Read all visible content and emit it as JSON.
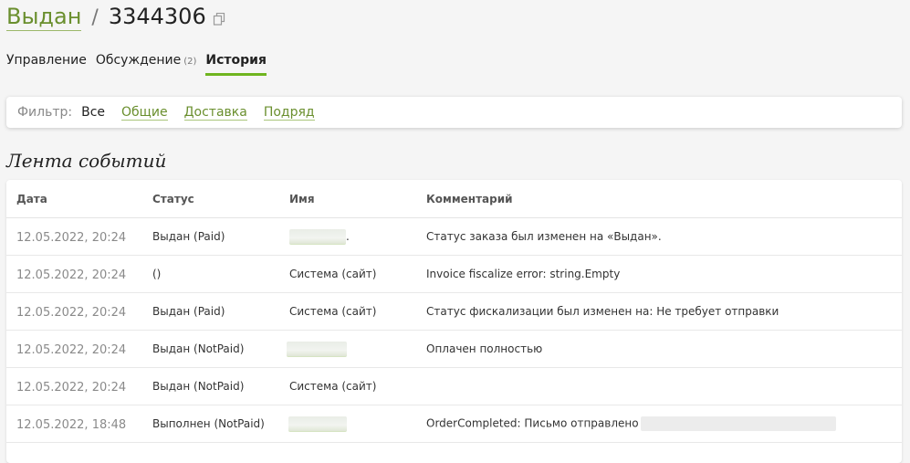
{
  "header": {
    "status_label": "Выдан",
    "separator": "/",
    "order_number": "3344306"
  },
  "tabs": [
    {
      "label": "Управление"
    },
    {
      "label": "Обсуждение",
      "count": "(2)"
    },
    {
      "label": "История",
      "active": true
    }
  ],
  "filter": {
    "label": "Фильтр:",
    "options": [
      "Все",
      "Общие",
      "Доставка",
      "Подряд"
    ],
    "selected": "Все"
  },
  "events": {
    "title": "Лента событий",
    "columns": {
      "date": "Дата",
      "status": "Статус",
      "name": "Имя",
      "comment": "Комментарий"
    },
    "rows": [
      {
        "date": "12.05.2022, 20:24",
        "status": "Выдан (Paid)",
        "name": ".",
        "comment": "Статус заказа был изменен на «Выдан»."
      },
      {
        "date": "12.05.2022, 20:24",
        "status": "()",
        "name": "Система (сайт)",
        "comment": "Invoice fiscalize error: string.Empty"
      },
      {
        "date": "12.05.2022, 20:24",
        "status": "Выдан (Paid)",
        "name": "Система (сайт)",
        "comment": "Статус фискализации был изменен на: Не требует отправки"
      },
      {
        "date": "12.05.2022, 20:24",
        "status": "Выдан (NotPaid)",
        "name": "",
        "comment": "Оплачен полностью"
      },
      {
        "date": "12.05.2022, 20:24",
        "status": "Выдан (NotPaid)",
        "name": "Система (сайт)",
        "comment": ""
      },
      {
        "date": "12.05.2022, 18:48",
        "status": "Выполнен (NotPaid)",
        "name": "",
        "comment": "OrderCompleted: Письмо отправлено"
      }
    ]
  },
  "colors": {
    "accent_green": "#6fb51f",
    "link_green": "#6a8f2e",
    "background": "#f5f5f5"
  },
  "icons": {
    "copy": "copy-icon"
  }
}
